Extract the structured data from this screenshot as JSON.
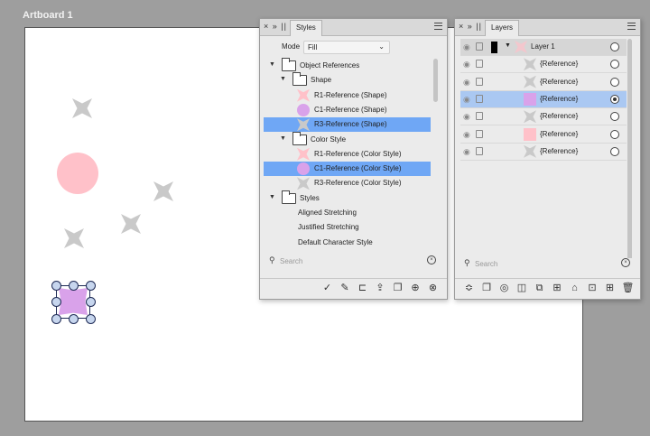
{
  "artboard": {
    "label": "Artboard 1"
  },
  "colors": {
    "pink": "#ffc1c9",
    "violet": "#d9a2ea",
    "gray_shape": "#c9c9c9",
    "selection_blue": "#6fa7f5",
    "layer_selection": "#aac8f2"
  },
  "styles_panel": {
    "controls": "× » ||",
    "tab": "Styles",
    "mode_label": "Mode",
    "mode_value": "Fill",
    "tree": [
      {
        "label": "Object References",
        "kind": "folder",
        "level": 0,
        "expanded": true,
        "selected": false
      },
      {
        "label": "Shape",
        "kind": "folder",
        "level": 1,
        "expanded": true,
        "selected": false
      },
      {
        "label": "R1-Reference (Shape)",
        "kind": "style",
        "swatch": "pink-star",
        "level": 2,
        "selected": false
      },
      {
        "label": "C1-Reference (Shape)",
        "kind": "style",
        "swatch": "violet-circle",
        "level": 2,
        "selected": false
      },
      {
        "label": "R3-Reference (Shape)",
        "kind": "style",
        "swatch": "gray-star",
        "level": 2,
        "selected": true
      },
      {
        "label": "Color Style",
        "kind": "folder",
        "level": 1,
        "expanded": true,
        "selected": false
      },
      {
        "label": "R1-Reference (Color Style)",
        "kind": "style",
        "swatch": "pink-star",
        "level": 2,
        "selected": false
      },
      {
        "label": "C1-Reference (Color Style)",
        "kind": "style",
        "swatch": "violet-circle",
        "level": 2,
        "selected": true
      },
      {
        "label": "R3-Reference (Color Style)",
        "kind": "style",
        "swatch": "gray-star",
        "level": 2,
        "selected": false
      },
      {
        "label": "Styles",
        "kind": "folder",
        "level": 0,
        "expanded": true,
        "selected": false
      },
      {
        "label": "Aligned Stretching",
        "kind": "text-style",
        "level": 2,
        "selected": false
      },
      {
        "label": "Justified Stretching",
        "kind": "text-style",
        "level": 2,
        "selected": false
      },
      {
        "label": "Default Character Style",
        "kind": "text-style",
        "level": 2,
        "selected": false
      }
    ],
    "search_placeholder": "Search",
    "toolbar_icons": [
      "apply-icon",
      "edit-icon",
      "detach-icon",
      "export-icon",
      "duplicate-icon",
      "add-icon",
      "remove-icon"
    ]
  },
  "layers_panel": {
    "controls": "× » ||",
    "tab": "Layers",
    "rows": [
      {
        "name": "Layer 1",
        "thumb": "layer",
        "header": true,
        "selected": false,
        "radio_on": false
      },
      {
        "name": "{Reference}",
        "thumb": "gray-star",
        "header": false,
        "selected": false,
        "radio_on": false
      },
      {
        "name": "{Reference}",
        "thumb": "gray-star",
        "header": false,
        "selected": false,
        "radio_on": false
      },
      {
        "name": "{Reference}",
        "thumb": "violet-square",
        "header": false,
        "selected": true,
        "radio_on": true
      },
      {
        "name": "{Reference}",
        "thumb": "gray-star",
        "header": false,
        "selected": false,
        "radio_on": false
      },
      {
        "name": "{Reference}",
        "thumb": "pink-square",
        "header": false,
        "selected": false,
        "radio_on": false
      },
      {
        "name": "{Reference}",
        "thumb": "gray-star",
        "header": false,
        "selected": false,
        "radio_on": false
      }
    ],
    "search_placeholder": "Search",
    "toolbar_icons": [
      "filter-icon",
      "duplicate-layer-icon",
      "mask-icon",
      "boolean-icon",
      "group-icon",
      "grid-icon",
      "snapshot-icon",
      "new-artboard-icon",
      "add-layer-icon",
      "delete-icon"
    ]
  }
}
